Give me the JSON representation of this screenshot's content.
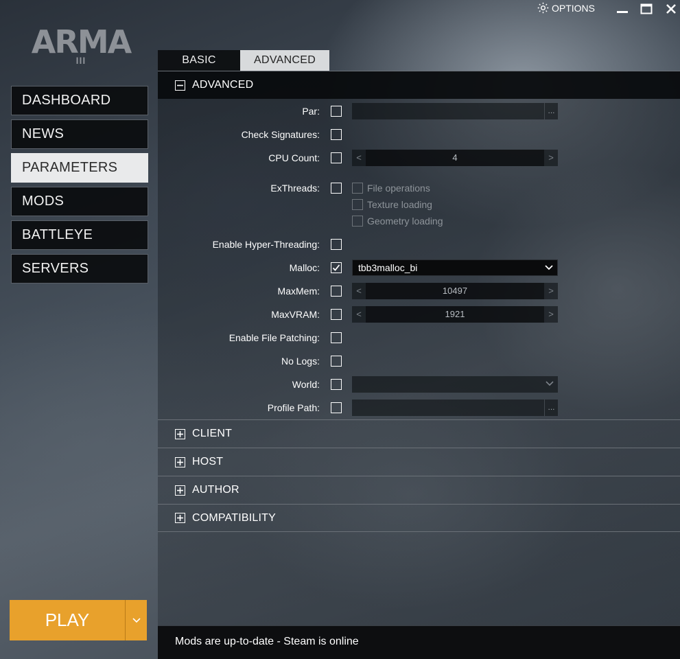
{
  "window": {
    "options_label": "OPTIONS"
  },
  "logo": {
    "text": "ARMA",
    "sub": "III"
  },
  "nav": {
    "items": [
      {
        "label": "DASHBOARD"
      },
      {
        "label": "NEWS"
      },
      {
        "label": "PARAMETERS"
      },
      {
        "label": "MODS"
      },
      {
        "label": "BATTLEYE"
      },
      {
        "label": "SERVERS"
      }
    ],
    "active": "PARAMETERS"
  },
  "play": {
    "label": "PLAY"
  },
  "tabs": [
    {
      "label": "BASIC"
    },
    {
      "label": "ADVANCED"
    }
  ],
  "advanced": {
    "title": "ADVANCED",
    "params": {
      "par": {
        "label": "Par:",
        "checked": false
      },
      "check_signatures": {
        "label": "Check Signatures:",
        "checked": false
      },
      "cpu_count": {
        "label": "CPU Count:",
        "checked": false,
        "value": "4"
      },
      "exthreads": {
        "label": "ExThreads:",
        "checked": false,
        "options": [
          "File operations",
          "Texture loading",
          "Geometry loading"
        ]
      },
      "hyper_threading": {
        "label": "Enable Hyper-Threading:",
        "checked": false
      },
      "malloc": {
        "label": "Malloc:",
        "checked": true,
        "value": "tbb3malloc_bi"
      },
      "maxmem": {
        "label": "MaxMem:",
        "checked": false,
        "value": "10497"
      },
      "maxvram": {
        "label": "MaxVRAM:",
        "checked": false,
        "value": "1921"
      },
      "file_patching": {
        "label": "Enable File Patching:",
        "checked": false
      },
      "no_logs": {
        "label": "No Logs:",
        "checked": false
      },
      "world": {
        "label": "World:",
        "checked": false
      },
      "profile_path": {
        "label": "Profile Path:",
        "checked": false
      }
    },
    "browse_label": "..."
  },
  "sections": [
    {
      "label": "CLIENT"
    },
    {
      "label": "HOST"
    },
    {
      "label": "AUTHOR"
    },
    {
      "label": "COMPATIBILITY"
    }
  ],
  "status": {
    "text": "Mods are up-to-date - Steam is online"
  },
  "colors": {
    "accent": "#e8a12c",
    "panel_dark": "#0a0b0c",
    "active_nav": "#e9eaeb"
  }
}
